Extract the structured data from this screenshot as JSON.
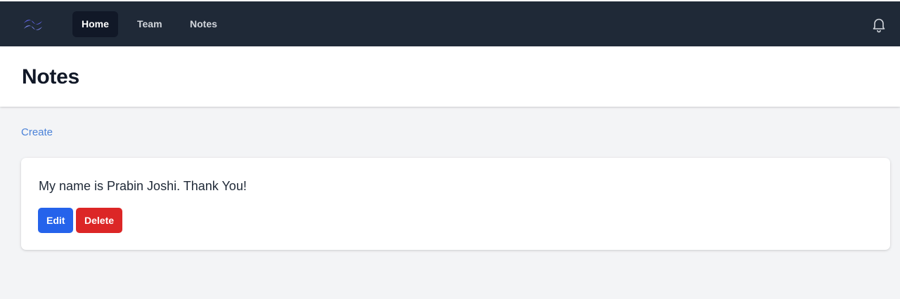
{
  "nav": {
    "links": [
      {
        "label": "Home",
        "active": true
      },
      {
        "label": "Team",
        "active": false
      },
      {
        "label": "Notes",
        "active": false
      }
    ],
    "logo_icon": "tailwind-logo-icon",
    "notification_icon": "bell-icon",
    "background_color": "#1f2937",
    "active_color": "#111827"
  },
  "header": {
    "title": "Notes"
  },
  "main": {
    "create_label": "Create",
    "notes": [
      {
        "text": "My name is Prabin Joshi. Thank You!",
        "edit_label": "Edit",
        "delete_label": "Delete"
      }
    ]
  },
  "colors": {
    "edit_button": "#2563eb",
    "delete_button": "#dc2626",
    "link": "#4b82d8",
    "page_background": "#f3f4f6"
  }
}
